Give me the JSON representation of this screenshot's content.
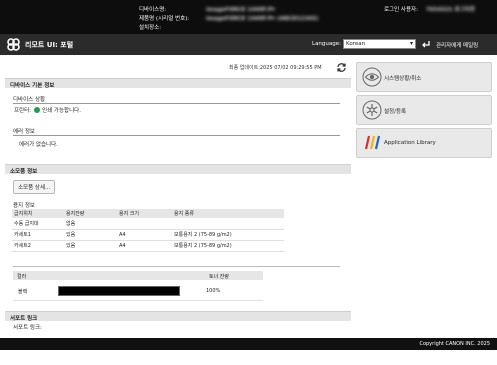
{
  "header": {
    "device_name_label": "디바이스명:",
    "device_name_value": "imageFORCE 1440F/Pr",
    "product_label": "제품명 (시리얼 번호):",
    "product_value": "imageFORCE 1440F/Pr (ABCD12345)",
    "location_label": "설치장소:",
    "login_label": "로그인 사용자:",
    "login_value": "7654321 로그아웃"
  },
  "titlebar": {
    "title": "리모트 UI: 포털",
    "language_label": "Language:",
    "language_value": "Korean",
    "mail_admin": "관리자에게 메일링"
  },
  "updated": "최종 업데이트:2025 07/02 09:29:55 PM",
  "device_basic": {
    "section": "디바이스 기본 정보",
    "status_title": "디바이스 상황",
    "printer_label": "프린터:",
    "printer_status": "인쇄 가능합니다.",
    "error_title": "에러 정보",
    "error_text": "에러가 없습니다."
  },
  "consumables": {
    "section": "소모품 정보",
    "detail_button": "소모품 상세...",
    "paper_title": "용지 정보",
    "paper_headers": [
      "급지위치",
      "용지잔량",
      "용지 크기",
      "용지 종류"
    ],
    "paper_rows": [
      [
        "수동 급지대",
        "없음",
        "",
        ""
      ],
      [
        "카세트1",
        "있음",
        "A4",
        "보통용지 2 (75-89 g/m2)"
      ],
      [
        "카세트2",
        "있음",
        "A4",
        "보통용지 2 (75-89 g/m2)"
      ]
    ],
    "toner_headers": [
      "컬러",
      "토너 잔량"
    ],
    "toner_rows": [
      {
        "color": "블랙",
        "percent": "100%",
        "level": 1.0
      }
    ]
  },
  "support": {
    "section": "서포트 링크",
    "link_label": "서포트 링크:"
  },
  "right_menu": [
    {
      "label": "시스템상황/취소",
      "icon": "eye-icon"
    },
    {
      "label": "설정/등록",
      "icon": "settings-icon"
    },
    {
      "label": "Application Library",
      "icon": "application-library-icon"
    }
  ],
  "footer": {
    "copyright": "Copyright CANON INC. 2025"
  },
  "colors": {
    "header_bg": "#0d0d0d",
    "titlebar_bg": "#2b2b2b",
    "status_ok": "#21a04b",
    "library_colors": [
      "#d9302c",
      "#f0b31d",
      "#2b63b8"
    ]
  }
}
